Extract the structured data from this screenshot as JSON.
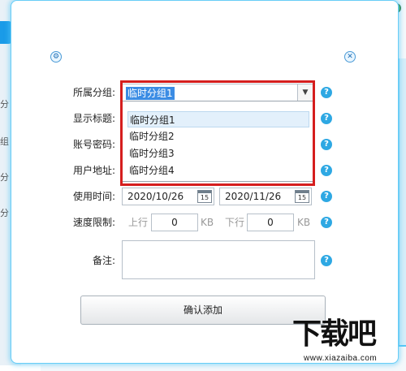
{
  "sidebar": {
    "items": [
      "分",
      "组",
      "分",
      "分"
    ]
  },
  "dialog": {
    "labels": {
      "group": "所属分组:",
      "title": "显示标题:",
      "account": "账号密码:",
      "address": "用户地址:",
      "usage_time": "使用时间:",
      "speed_limit": "速度限制:",
      "note": "备注:"
    },
    "group_select": {
      "value": "临时分组1",
      "options": [
        "临时分组1",
        "临时分组2",
        "临时分组3",
        "临时分组4"
      ]
    },
    "usage_time": {
      "start": "2020/10/26",
      "end": "2020/11/26",
      "calendar_day": "15"
    },
    "speed_limit": {
      "upload_label": "上行",
      "upload_value": "0",
      "upload_unit": "KB",
      "download_label": "下行",
      "download_value": "0",
      "download_unit": "KB"
    },
    "help_symbol": "?",
    "confirm_label": "确认添加"
  },
  "watermark": {
    "logo": "下载吧",
    "url": "www.xiazaiba.com"
  },
  "icons": {
    "left_circle": "settings-icon",
    "right_circle": "close-icon",
    "help": "help-icon",
    "calendar": "calendar-icon",
    "dropdown_arrow": "chevron-down-icon"
  },
  "colors": {
    "accent": "#2ea8e3",
    "dialog_glow": "#68cdf7",
    "selection": "#3b8ce4",
    "highlight_frame": "#d51e1e"
  }
}
